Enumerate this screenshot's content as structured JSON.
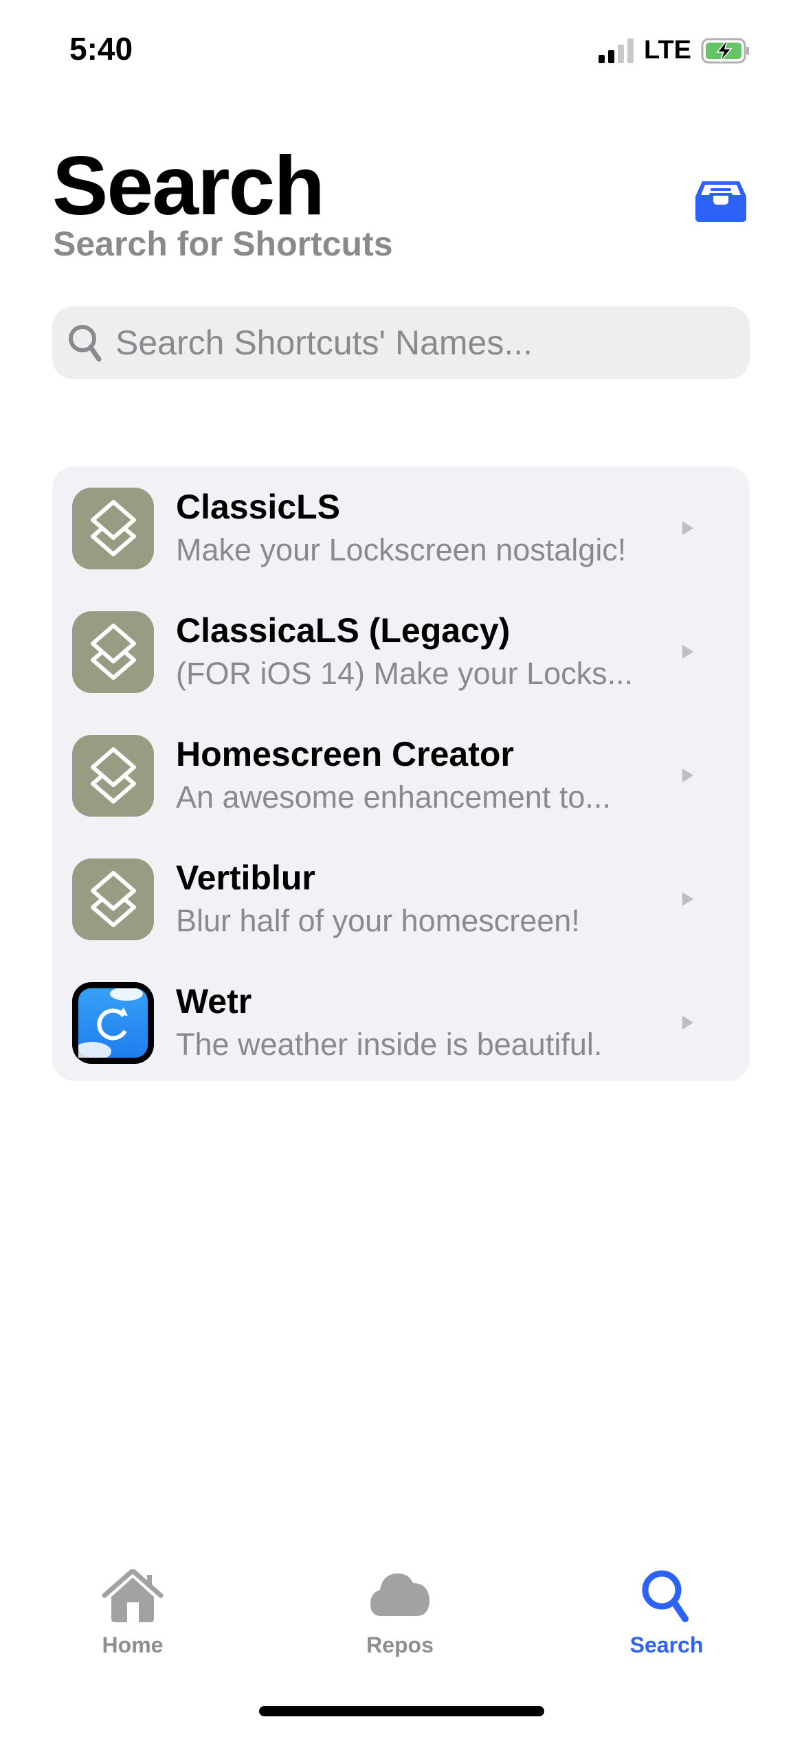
{
  "status_bar": {
    "time": "5:40",
    "network": "LTE",
    "signal_bars": 2,
    "battery_charging": true
  },
  "header": {
    "title": "Search",
    "subtitle": "Search for Shortcuts",
    "inbox_icon": "tray-icon"
  },
  "search": {
    "placeholder": "Search Shortcuts' Names...",
    "value": ""
  },
  "results": [
    {
      "name": "ClassicLS",
      "description": "Make your Lockscreen nostalgic!",
      "icon": "shortcuts-icon"
    },
    {
      "name": "ClassicaLS (Legacy)",
      "description": "(FOR iOS 14) Make your Locks...",
      "icon": "shortcuts-icon"
    },
    {
      "name": "Homescreen Creator",
      "description": "An awesome enhancement to...",
      "icon": "shortcuts-icon"
    },
    {
      "name": "Vertiblur",
      "description": "Blur half of your homescreen!",
      "icon": "shortcuts-icon"
    },
    {
      "name": "Wetr",
      "description": "The weather inside is beautiful.",
      "icon": "wetr-app-icon"
    }
  ],
  "tabbar": {
    "items": [
      {
        "label": "Home",
        "icon": "house-icon"
      },
      {
        "label": "Repos",
        "icon": "cloud-icon"
      },
      {
        "label": "Search",
        "icon": "magnifier-icon",
        "active": true
      }
    ]
  },
  "colors": {
    "accent": "#2c62f5",
    "secondary_text": "#8a8a8e",
    "card_bg": "#f1f1f6",
    "shortcut_icon_bg": "#979c82"
  }
}
